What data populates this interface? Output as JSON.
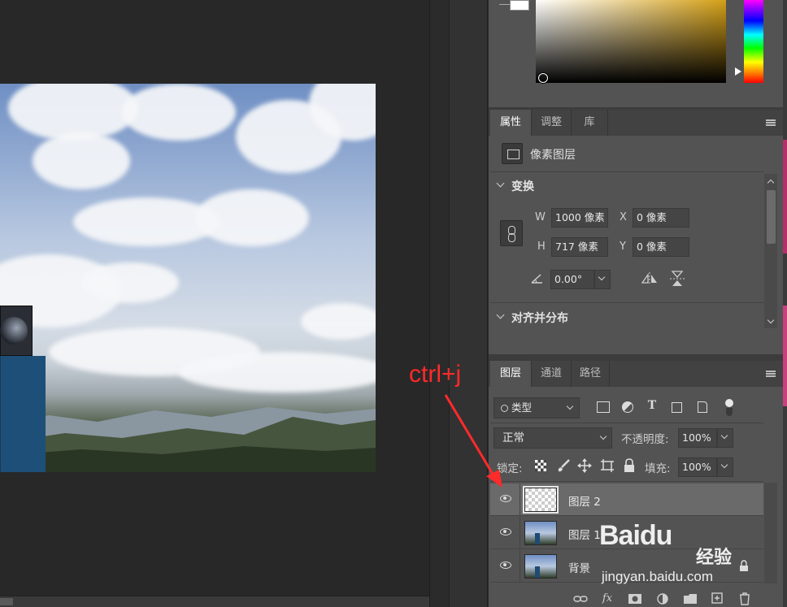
{
  "properties_panel": {
    "tabs": [
      "属性",
      "调整",
      "库"
    ],
    "active_tab": "属性",
    "layer_kind": "像素图层",
    "transform": {
      "title": "变换",
      "w_label": "W",
      "w_value": "1000 像素",
      "h_label": "H",
      "h_value": "717 像素",
      "x_label": "X",
      "x_value": "0 像素",
      "y_label": "Y",
      "y_value": "0 像素",
      "angle_value": "0.00°"
    },
    "align_section_title": "对齐并分布"
  },
  "layers_panel": {
    "tabs": [
      "图层",
      "通道",
      "路径"
    ],
    "active_tab": "图层",
    "filter_kind": "类型",
    "blend_mode": "正常",
    "opacity_label": "不透明度:",
    "opacity_value": "100%",
    "lock_label": "锁定:",
    "fill_label": "填充:",
    "fill_value": "100%",
    "filter_icons": [
      "image-filter-icon",
      "adjustment-filter-icon",
      "type-filter-icon",
      "shape-filter-icon",
      "smart-object-filter-icon",
      "filter-toggle-icon"
    ],
    "lock_icons": [
      "lock-transparent-icon",
      "lock-paint-icon",
      "lock-position-icon",
      "lock-artboard-icon",
      "lock-all-icon"
    ],
    "layers": [
      {
        "name": "图层 2",
        "visible": true,
        "selected": true,
        "thumbnail": "transparent"
      },
      {
        "name": "图层 1",
        "visible": true,
        "selected": false,
        "thumbnail": "image"
      },
      {
        "name": "背景",
        "visible": true,
        "selected": false,
        "thumbnail": "image"
      }
    ],
    "footer_icons": [
      "link-layers-icon",
      "fx-icon",
      "layer-mask-icon",
      "adjustment-layer-icon",
      "group-folder-icon",
      "new-layer-icon",
      "trash-icon"
    ],
    "fx_label": "fx"
  },
  "annotation": {
    "text": "ctrl+j",
    "color": "#ff2a2a"
  },
  "watermark": {
    "logo": "Baidu",
    "logo_cn": "经验",
    "url": "jingyan.baidu.com"
  },
  "colors": {
    "accent_fill": "#d4a017",
    "panel_bg": "#535353",
    "selected_row": "#6a6a6a"
  }
}
